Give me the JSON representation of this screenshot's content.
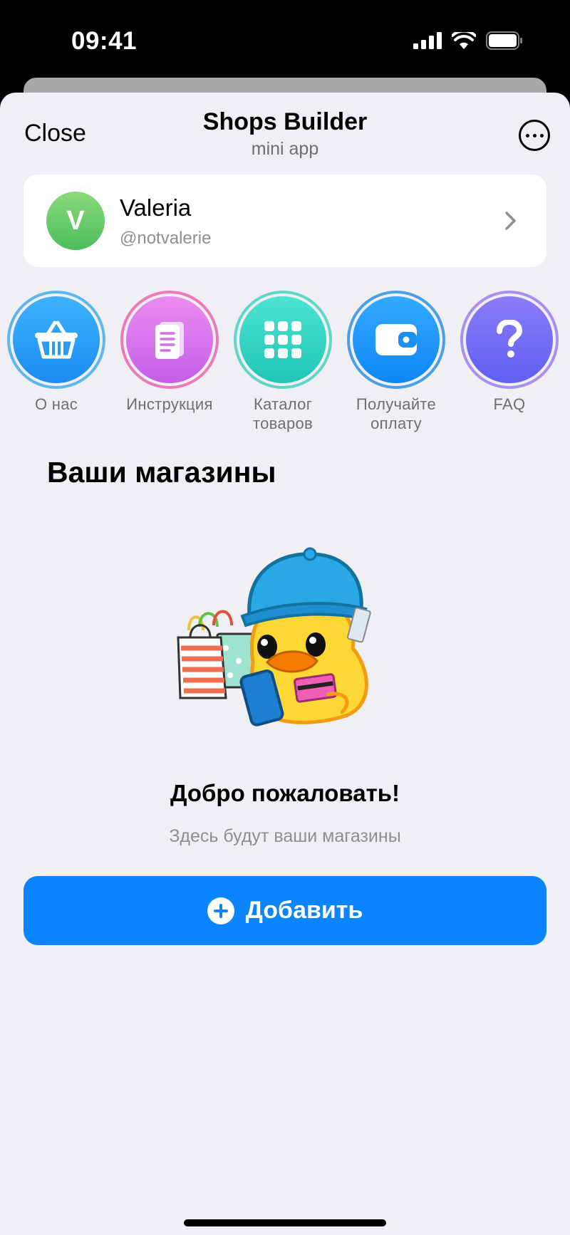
{
  "status_bar": {
    "time": "09:41"
  },
  "header": {
    "close_label": "Close",
    "title": "Shops Builder",
    "subtitle": "mini app"
  },
  "profile": {
    "initial": "V",
    "name": "Valeria",
    "handle": "@notvalerie"
  },
  "actions": [
    {
      "label": "О нас",
      "icon": "basket-icon",
      "color": "#1e9bf5"
    },
    {
      "label": "Инструкция",
      "icon": "document-icon",
      "color": "#d86fe6"
    },
    {
      "label": "Каталог\nтоваров",
      "icon": "grid-icon",
      "color": "#2fd5c4"
    },
    {
      "label": "Получайте\nоплату",
      "icon": "wallet-icon",
      "color": "#178df7"
    },
    {
      "label": "FAQ",
      "icon": "question-icon",
      "color": "#7a63f5"
    }
  ],
  "section_title": "Ваши магазины",
  "empty_state": {
    "title": "Добро пожаловать!",
    "subtitle": "Здесь будут ваши магазины"
  },
  "add_button": {
    "label": "Добавить"
  },
  "colors": {
    "accent": "#0a84ff",
    "background": "#efeff4"
  }
}
